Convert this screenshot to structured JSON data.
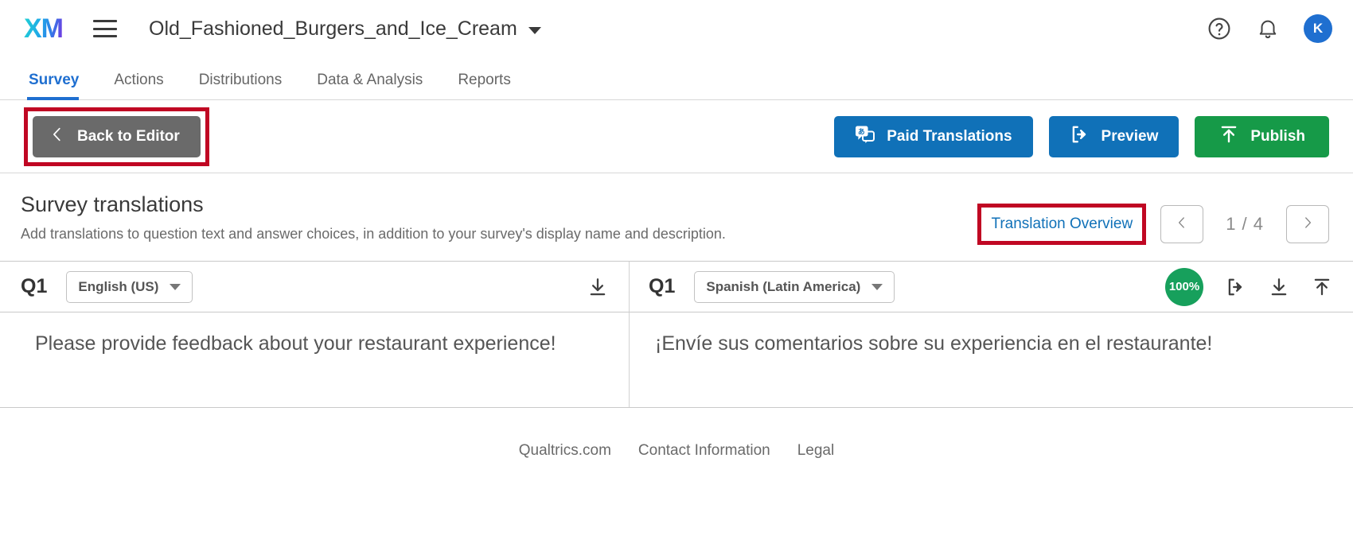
{
  "topbar": {
    "logo_text": "XM",
    "survey_name": "Old_Fashioned_Burgers_and_Ice_Cream",
    "avatar_initial": "K",
    "icons": {
      "menu": "hamburger-icon",
      "survey_caret": "chevron-down-icon",
      "help": "help-circle-icon",
      "notifications": "bell-icon"
    }
  },
  "nav": {
    "tabs": [
      {
        "label": "Survey",
        "active": true
      },
      {
        "label": "Actions",
        "active": false
      },
      {
        "label": "Distributions",
        "active": false
      },
      {
        "label": "Data & Analysis",
        "active": false
      },
      {
        "label": "Reports",
        "active": false
      }
    ]
  },
  "actionbar": {
    "back_label": "Back to Editor",
    "paid_translations_label": "Paid Translations",
    "preview_label": "Preview",
    "publish_label": "Publish"
  },
  "translations": {
    "title": "Survey translations",
    "description": "Add translations to question text and answer choices, in addition to your survey's display name and description.",
    "overview_link": "Translation Overview",
    "page_indicator": "1 / 4"
  },
  "rows": [
    {
      "question_id": "Q1",
      "source": {
        "language": "English (US)",
        "text": "Please provide feedback about your restaurant experience!"
      },
      "target": {
        "language": "Spanish (Latin America)",
        "text": "¡Envíe sus comentarios sobre su experiencia en el restaurante!",
        "completion": "100%"
      }
    }
  ],
  "footer": {
    "links": [
      "Qualtrics.com",
      "Contact Information",
      "Legal"
    ]
  },
  "colors": {
    "accent_blue": "#1071b8",
    "active_tab_blue": "#1f6fd0",
    "publish_green": "#169a48",
    "badge_green": "#17a05c",
    "annotation_red": "#c00723",
    "back_gray": "#6a6a6a"
  }
}
